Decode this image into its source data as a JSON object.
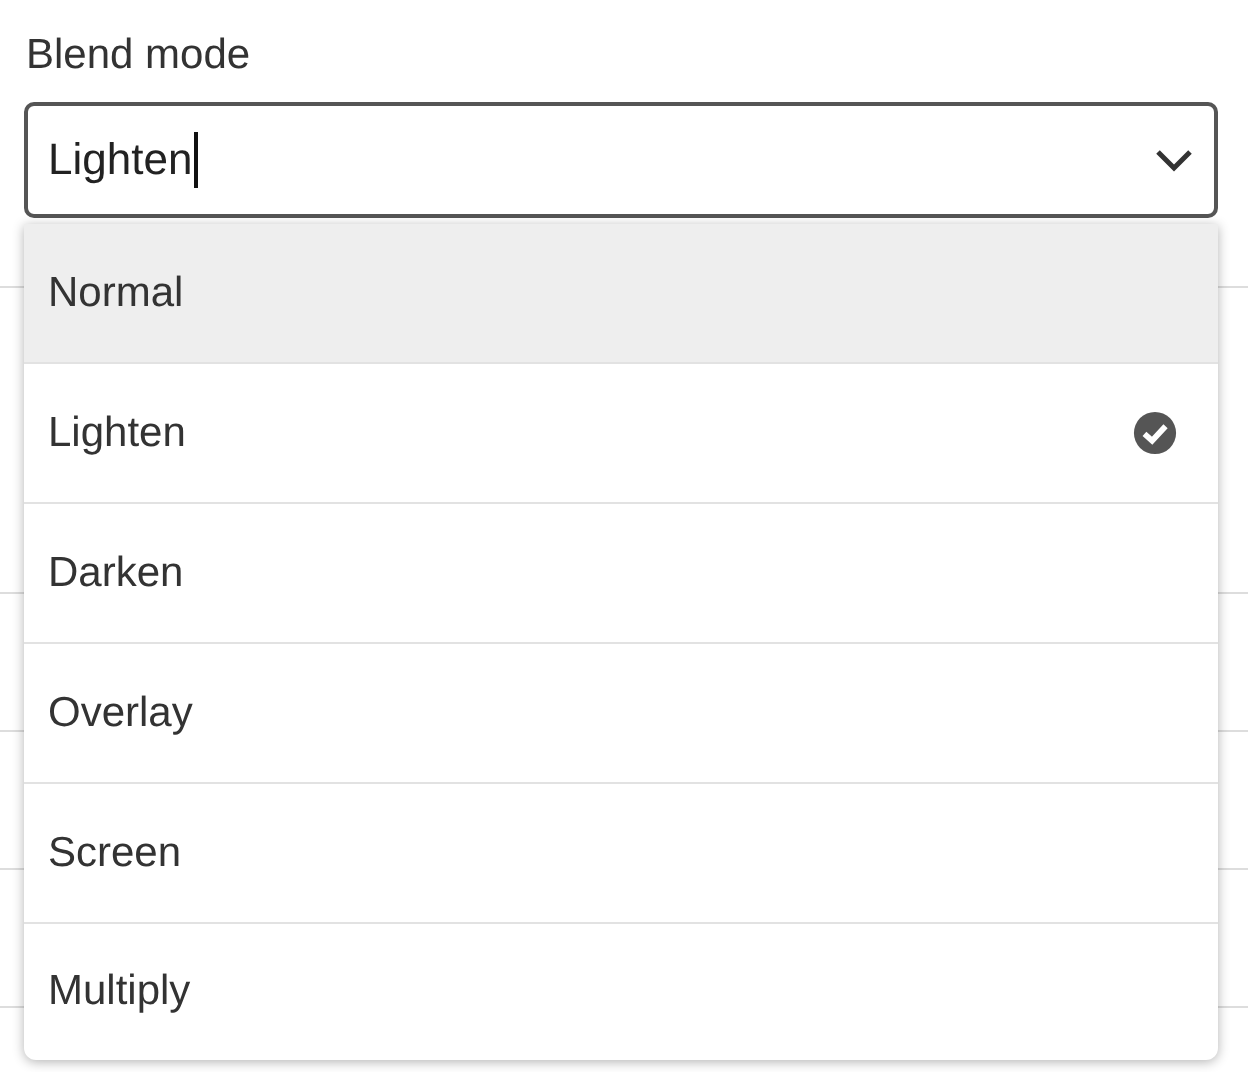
{
  "field": {
    "label": "Blend mode",
    "value": "Lighten",
    "focused": true
  },
  "options": [
    {
      "label": "Normal",
      "selected": false,
      "highlighted": true
    },
    {
      "label": "Lighten",
      "selected": true,
      "highlighted": false
    },
    {
      "label": "Darken",
      "selected": false,
      "highlighted": false
    },
    {
      "label": "Overlay",
      "selected": false,
      "highlighted": false
    },
    {
      "label": "Screen",
      "selected": false,
      "highlighted": false
    },
    {
      "label": "Multiply",
      "selected": false,
      "highlighted": false
    }
  ]
}
